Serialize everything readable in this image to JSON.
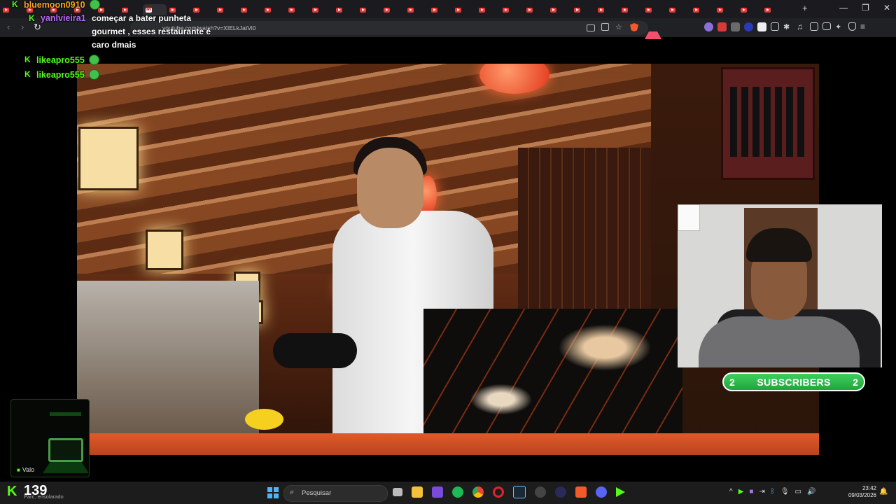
{
  "browser": {
    "url": "youtube.com/watch?v=XIELkJatVi0",
    "new_tab_symbol": "+",
    "window_controls": {
      "minimize": "—",
      "maximize": "❐",
      "close": "✕"
    },
    "nav": {
      "back": "‹",
      "forward": "›",
      "reload": "↻"
    }
  },
  "chat": {
    "messages": [
      {
        "user": "bluemoon0910",
        "color": "#f5a623",
        "text": ""
      },
      {
        "user": "yanlvieira1",
        "color": "#b56cf0",
        "text": "começar a bater punheta gourmet , esses restaurante é caro dmais"
      },
      {
        "user": "likeapro555",
        "color": "#53fc18",
        "text": ""
      },
      {
        "user": "likeapro555",
        "color": "#53fc18",
        "text": ""
      }
    ]
  },
  "subscribers": {
    "left": "2",
    "label": "SUBSCRIBERS",
    "right": "2"
  },
  "widget": {
    "label": "Valo"
  },
  "stream": {
    "viewer_count": "139",
    "status": "Parc. ensolarado"
  },
  "taskbar": {
    "search_placeholder": "Pesquisar",
    "time": "23:42",
    "date": "09/03/2026",
    "tray_chevron": "^"
  },
  "colors": {
    "kick_green": "#53fc18",
    "tab_red": "#e53935",
    "subs_green": "#22a53c"
  }
}
